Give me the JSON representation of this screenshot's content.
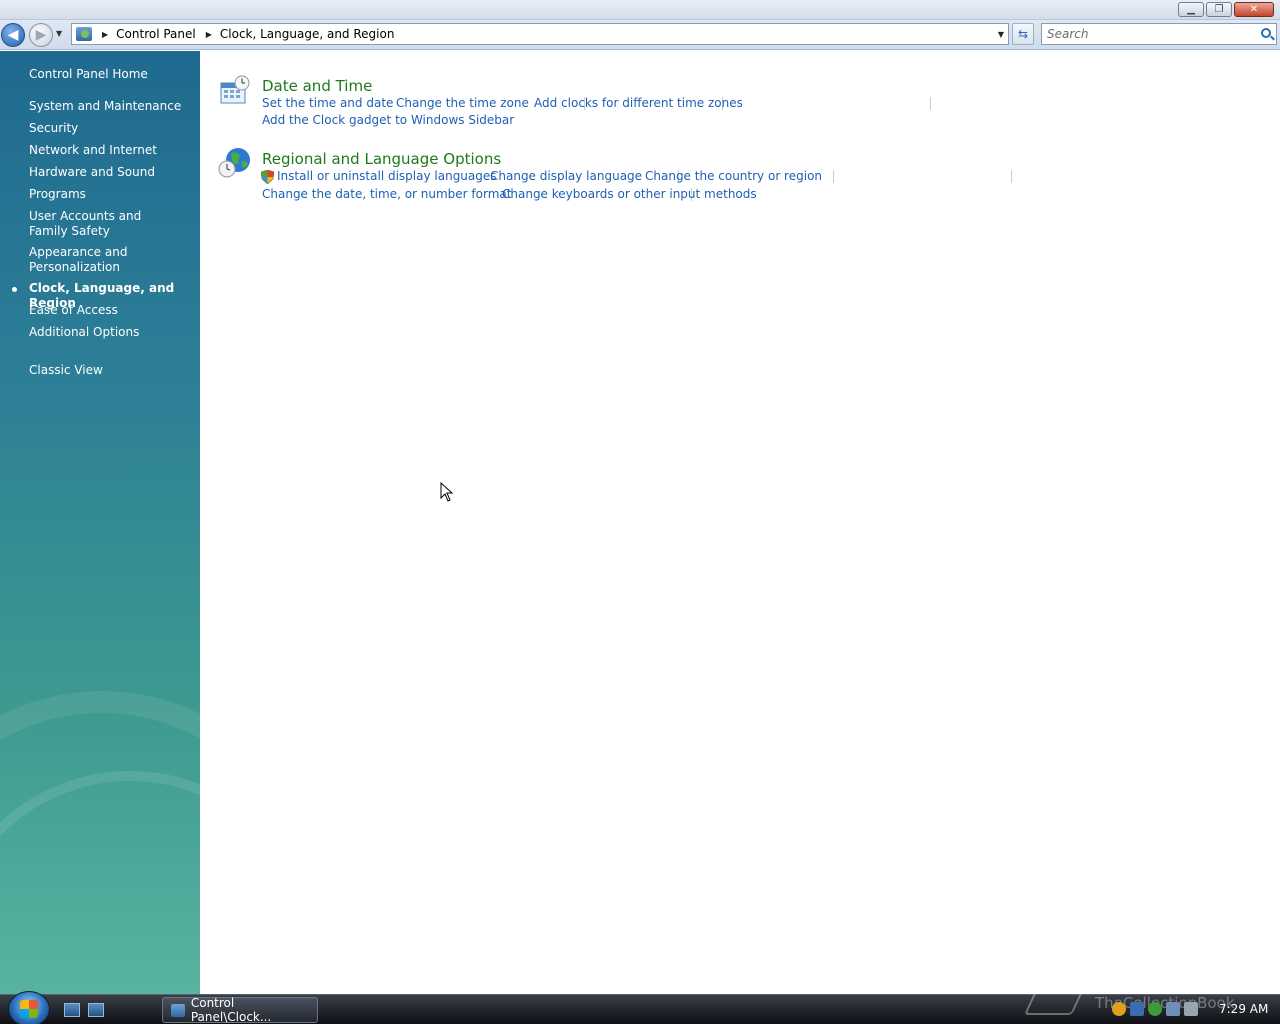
{
  "window": {
    "minimize_glyph": "▁",
    "maximize_glyph": "❐",
    "close_glyph": "✕"
  },
  "address": {
    "crumbs": [
      "Control Panel",
      "Clock, Language, and Region"
    ],
    "search_placeholder": "Search"
  },
  "sidebar": {
    "home": "Control Panel Home",
    "items": [
      "System and Maintenance",
      "Security",
      "Network and Internet",
      "Hardware and Sound",
      "Programs",
      "User Accounts and Family Safety",
      "Appearance and Personalization",
      "Clock, Language, and Region",
      "Ease of Access",
      "Additional Options"
    ],
    "current": "Clock, Language, and Region",
    "classic_view": "Classic View"
  },
  "categories": {
    "date_time": {
      "title": "Date and Time",
      "icon": "calendar-clock-icon",
      "tasks": [
        "Set the time and date",
        "Change the time zone",
        "Add clocks for different time zones",
        "Add the Clock gadget to Windows Sidebar"
      ]
    },
    "regional": {
      "title": "Regional and Language Options",
      "icon": "globe-clock-icon",
      "tasks": [
        "Install or uninstall display languages",
        "Change display language",
        "Change the country or region",
        "Change the date, time, or number format",
        "Change keyboards or other input methods"
      ]
    }
  },
  "taskbar": {
    "task_button": "Control Panel\\Clock...",
    "watermark": "TheCollectionBook",
    "clock": "7:29 AM"
  },
  "colors": {
    "link": "#1f5fb5",
    "category_title": "#1e7a1e",
    "sidebar_top": "#1f6a8f",
    "sidebar_bottom": "#58b3a0"
  }
}
